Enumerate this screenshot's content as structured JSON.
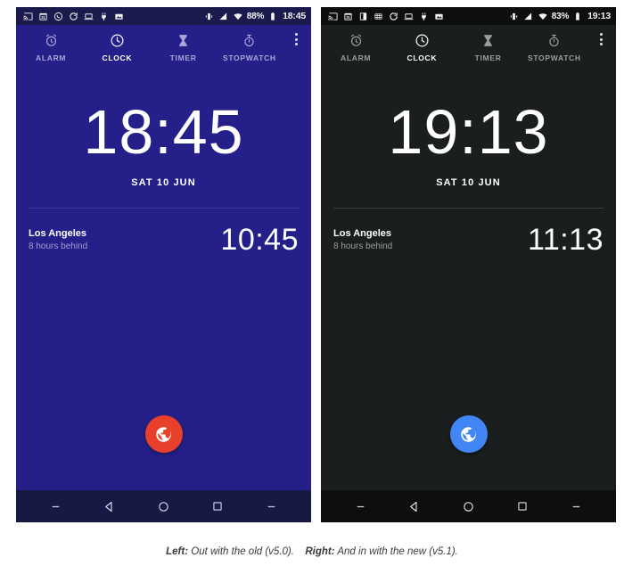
{
  "caption": {
    "left_label": "Left:",
    "left_text": "Out with the old (v5.0).",
    "right_label": "Right:",
    "right_text": "And in with the new (v5.1)."
  },
  "phones": [
    {
      "theme": "light",
      "accent": "#252089",
      "statusbar_bg": "#1a1a4d",
      "fab_color": "#e8402a",
      "statusbar": {
        "left_icons": [
          "cast-icon",
          "calendar-icon",
          "whatsapp-icon",
          "sync-icon",
          "laptop-icon",
          "plug-icon",
          "image-icon"
        ],
        "right_icons": [
          "vibrate-icon",
          "signal-icon",
          "wifi-icon"
        ],
        "battery_percent": "88%",
        "battery_icon": "battery-icon",
        "time": "18:45"
      },
      "tabs": [
        {
          "label": "ALARM",
          "icon": "alarm-icon",
          "active": false
        },
        {
          "label": "CLOCK",
          "icon": "clock-icon",
          "active": true
        },
        {
          "label": "TIMER",
          "icon": "hourglass-icon",
          "active": false
        },
        {
          "label": "STOPWATCH",
          "icon": "stopwatch-icon",
          "active": false
        }
      ],
      "overflow_icon": "overflow-menu-icon",
      "clock": {
        "time": "18:45",
        "date": "SAT 10 JUN"
      },
      "world_clock": {
        "city": "Los Angeles",
        "offset": "8 hours behind",
        "time": "10:45"
      },
      "fab_icon": "globe-icon",
      "navbar": [
        "minimize-icon",
        "back-icon",
        "home-icon",
        "recents-icon",
        "minimize-icon"
      ]
    },
    {
      "theme": "dark",
      "accent": "#1b1e1f",
      "statusbar_bg": "#0c0e0f",
      "fab_color": "#4285f4",
      "statusbar": {
        "left_icons": [
          "cast-icon",
          "calendar-icon",
          "contrast-icon",
          "grid-icon",
          "sync-icon",
          "laptop-icon",
          "plug-icon",
          "image-icon"
        ],
        "right_icons": [
          "vibrate-icon",
          "signal-icon",
          "wifi-icon"
        ],
        "battery_percent": "83%",
        "battery_icon": "battery-icon",
        "time": "19:13"
      },
      "tabs": [
        {
          "label": "ALARM",
          "icon": "alarm-icon",
          "active": false
        },
        {
          "label": "CLOCK",
          "icon": "clock-icon",
          "active": true
        },
        {
          "label": "TIMER",
          "icon": "hourglass-icon",
          "active": false
        },
        {
          "label": "STOPWATCH",
          "icon": "stopwatch-icon",
          "active": false
        }
      ],
      "overflow_icon": "overflow-menu-icon",
      "clock": {
        "time": "19:13",
        "date": "SAT 10 JUN"
      },
      "world_clock": {
        "city": "Los Angeles",
        "offset": "8 hours behind",
        "time": "11:13"
      },
      "fab_icon": "globe-icon",
      "navbar": [
        "minimize-icon",
        "back-icon",
        "home-icon",
        "recents-icon",
        "minimize-icon"
      ]
    }
  ]
}
